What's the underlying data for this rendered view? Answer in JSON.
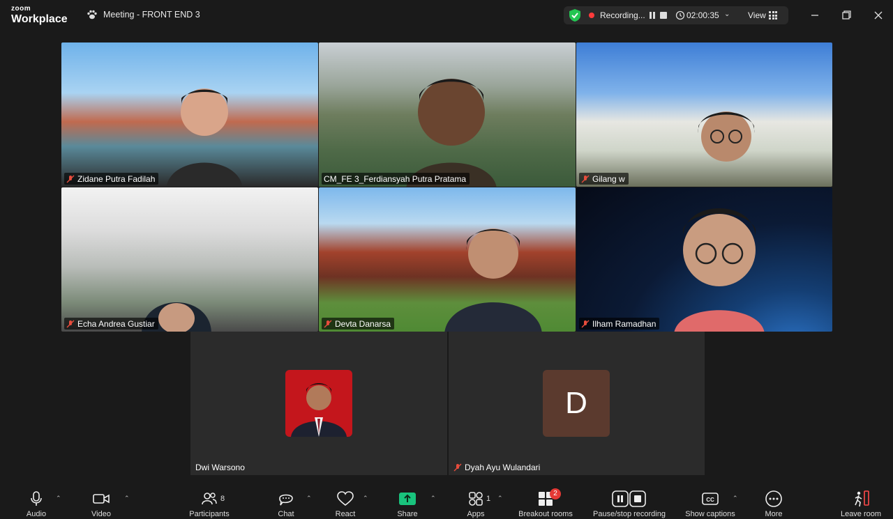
{
  "app": {
    "brand_small": "zoom",
    "brand_large": "Workplace"
  },
  "meeting": {
    "title": "Meeting - FRONT END 3"
  },
  "recording": {
    "label": "Recording...",
    "elapsed": "02:00:35"
  },
  "view": {
    "label": "View"
  },
  "participants": [
    {
      "name": "Zidane Putra Fadilah",
      "muted": true
    },
    {
      "name": "CM_FE 3_Ferdiansyah Putra Pratama",
      "muted": false,
      "active_speaker": true
    },
    {
      "name": "Gilang w",
      "muted": true
    },
    {
      "name": "Echa Andrea Gustiar",
      "muted": true
    },
    {
      "name": "Devta Danarsa",
      "muted": true
    },
    {
      "name": "Ilham Ramadhan",
      "muted": true
    },
    {
      "name": "Dwi Warsono",
      "muted": false
    },
    {
      "name": "Dyah Ayu Wulandari",
      "muted": true,
      "avatar_letter": "D"
    }
  ],
  "toolbar": {
    "audio": "Audio",
    "video": "Video",
    "participants": "Participants",
    "participants_count": "8",
    "chat": "Chat",
    "react": "React",
    "share": "Share",
    "apps": "Apps",
    "apps_count": "1",
    "breakout": "Breakout rooms",
    "breakout_badge": "2",
    "pause_stop": "Pause/stop recording",
    "captions": "Show captions",
    "more": "More",
    "leave": "Leave room"
  },
  "colors": {
    "active_border": "#2fd17a",
    "share_green": "#19c37d",
    "rec_red": "#ff3b3b",
    "avatar_brown": "#5b3a2e"
  }
}
